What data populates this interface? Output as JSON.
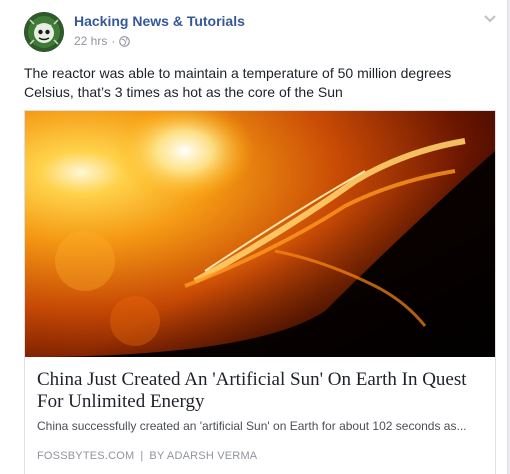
{
  "post": {
    "author": "Hacking News & Tutorials",
    "timestamp": "22 hrs",
    "dot": "·",
    "privacy_icon": "globe-icon",
    "menu_icon": "chevron-down-icon",
    "text": "The reactor was able to maintain a temperature of 50 million degrees Celsius, that’s 3 times as hot as the core of the Sun"
  },
  "link_card": {
    "title": "China Just Created An 'Artificial Sun' On Earth In Quest For Unlimited Energy",
    "description": "China successfully created an 'artificial Sun' on Earth for about 102 seconds as...",
    "domain": "FOSSBYTES.COM",
    "separator": "|",
    "byline": "BY ADARSH VERMA"
  },
  "colors": {
    "author": "#365899",
    "meta": "#90949c",
    "text": "#1d2129"
  }
}
